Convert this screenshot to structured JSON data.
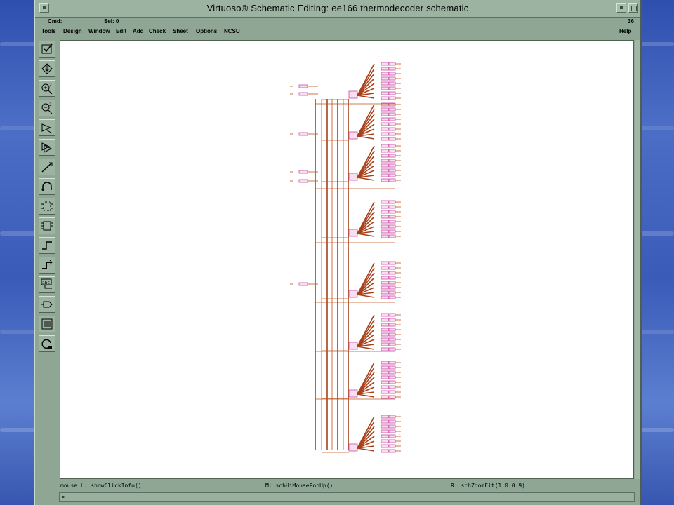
{
  "window": {
    "title": "Virtuoso® Schematic Editing: ee166 thermodecoder schematic"
  },
  "status": {
    "cmd_label": "Cmd:",
    "sel_label": "Sel: 0",
    "counter": "36"
  },
  "menu": {
    "items": [
      "Tools",
      "Design",
      "Window",
      "Edit",
      "Add",
      "Check",
      "Sheet",
      "Options",
      "NCSU"
    ],
    "help": "Help"
  },
  "toolbar": {
    "icons": [
      "check-icon",
      "save-icon",
      "zoom-in-icon",
      "zoom-out-icon",
      "stretch-icon",
      "copy-icon",
      "wire-icon",
      "undo-icon",
      "instance-icon",
      "pin-icon",
      "wire-narrow-icon",
      "wire-wide-icon",
      "label-icon",
      "property-icon",
      "window-icon",
      "redo-icon"
    ]
  },
  "mouse_bar": {
    "left": "mouse L: showClickInfo()",
    "middle": "M: schHiMousePopUp()",
    "right": "R: schZoomFit(1.0 0.9)"
  },
  "command_line": {
    "prompt": ">"
  },
  "colors": {
    "window_frame": "#8fa694",
    "canvas": "#ffffff",
    "wire": "#c0501e",
    "instance": "#d04aa8"
  }
}
